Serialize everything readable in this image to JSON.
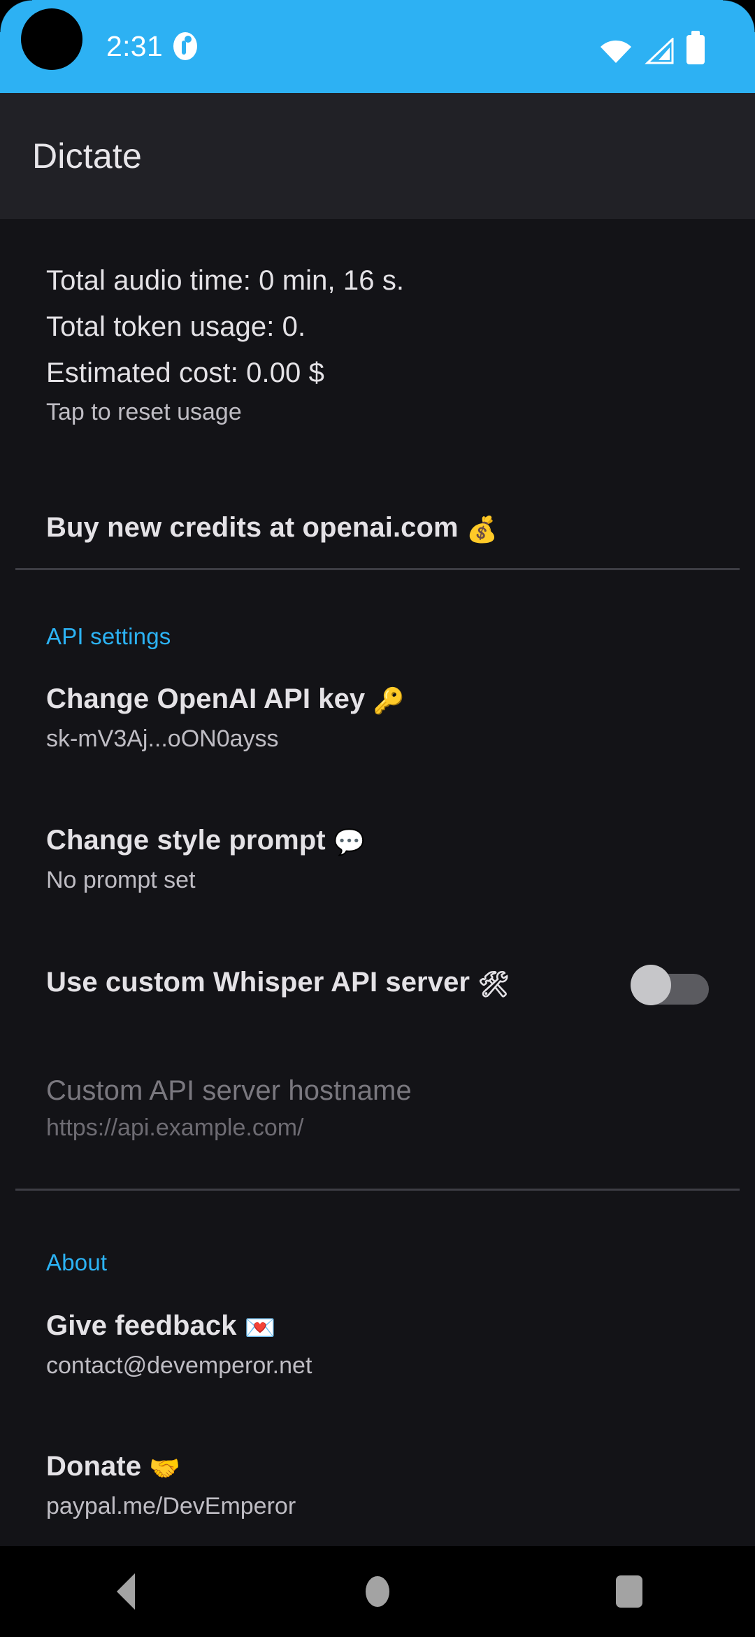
{
  "status_bar": {
    "time": "2:31",
    "background_color": "#2db1f3",
    "icons": [
      "alarm-clock-icon",
      "wifi-icon",
      "cellular-signal-icon",
      "battery-icon"
    ]
  },
  "app_bar": {
    "title": "Dictate"
  },
  "usage": {
    "audio_time": "Total audio time: 0 min, 16 s.",
    "token_usage": "Total token usage: 0.",
    "estimated_cost": "Estimated cost: 0.00 $",
    "reset_hint": "Tap to reset usage"
  },
  "buy_credits": {
    "title": "Buy new credits at openai.com",
    "emoji": "💰"
  },
  "sections": [
    {
      "header": "API settings",
      "accent_color": "#2cb3f5",
      "items": [
        {
          "title": "Change OpenAI API key",
          "emoji": "🔑",
          "summary": "sk-mV3Aj...oON0ayss",
          "type": "link"
        },
        {
          "title": "Change style prompt",
          "emoji": "💬",
          "summary": "No prompt set",
          "type": "link"
        },
        {
          "title": "Use custom Whisper API server",
          "emoji": "🛠",
          "summary": "",
          "type": "switch",
          "switch_on": false
        },
        {
          "title": "Custom API server hostname",
          "emoji": "",
          "summary": "https://api.example.com/",
          "type": "text",
          "disabled": true
        }
      ]
    },
    {
      "header": "About",
      "accent_color": "#2cb3f5",
      "items": [
        {
          "title": "Give feedback",
          "emoji": "💌",
          "summary": "contact@devemperor.net",
          "type": "link"
        },
        {
          "title": "Donate",
          "emoji": "🤝",
          "summary": "paypal.me/DevEmperor",
          "type": "link"
        }
      ]
    }
  ],
  "nav_bar": {
    "back": "Back",
    "home": "Home",
    "recents": "Recents"
  }
}
